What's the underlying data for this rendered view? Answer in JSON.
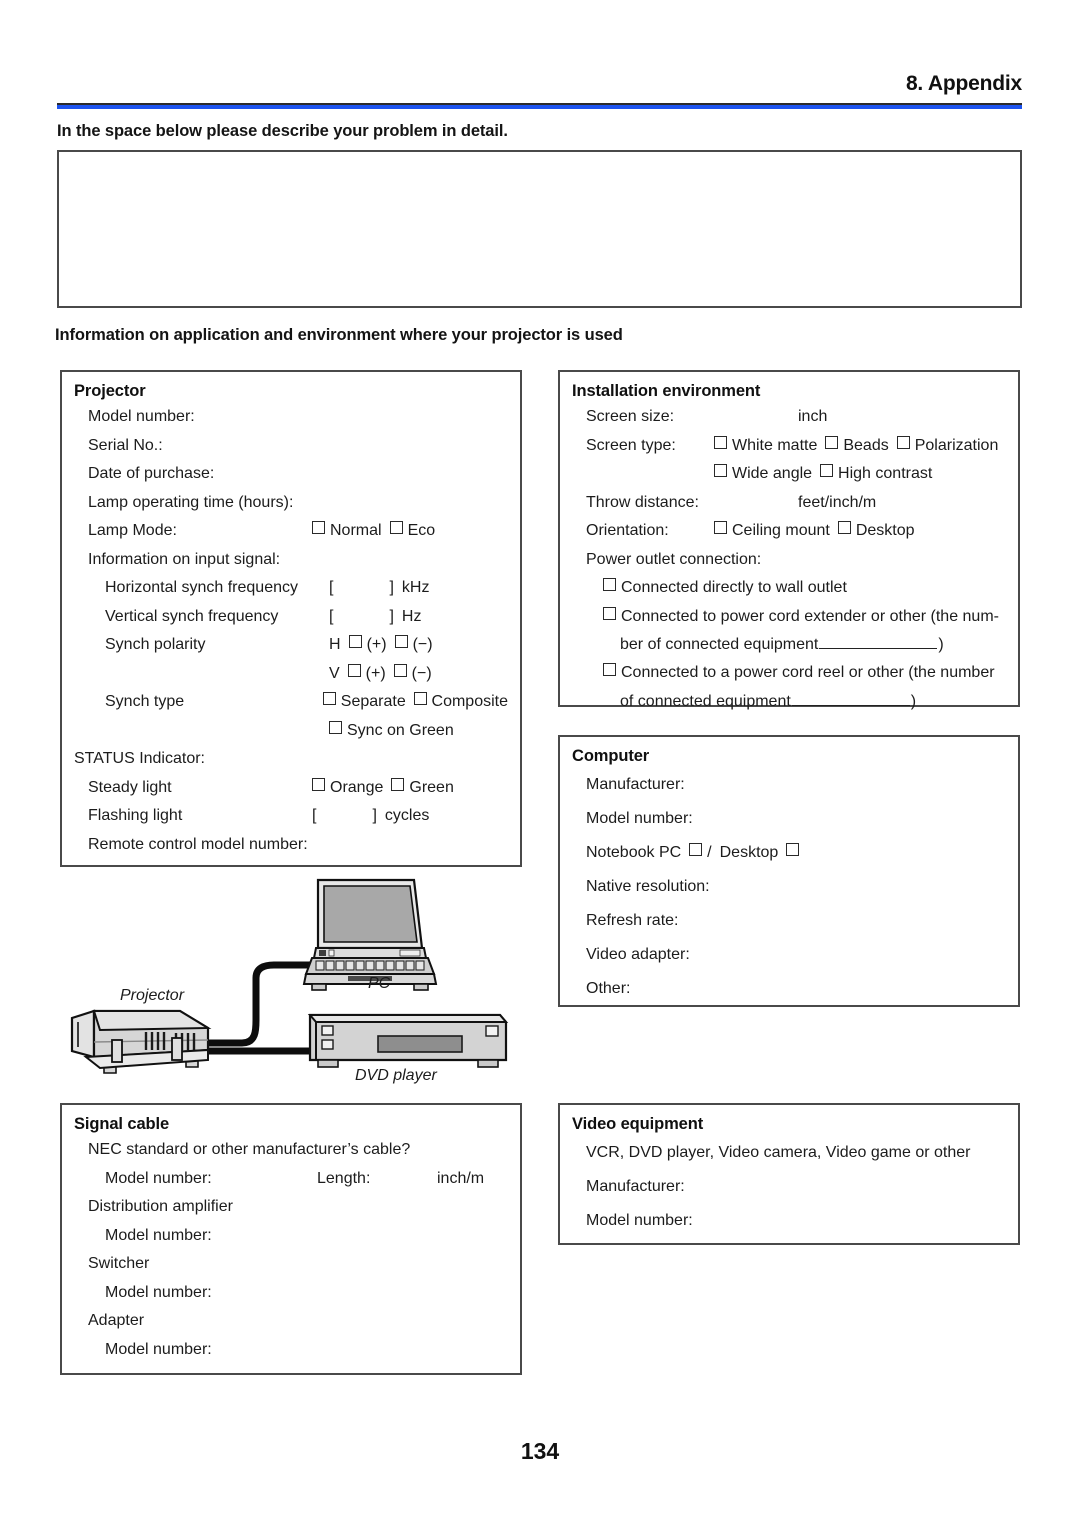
{
  "header": {
    "title": "8. Appendix",
    "rule_color": "#1d53ef"
  },
  "problem": {
    "prompt": "In the space below please describe your problem in detail.",
    "box_value": ""
  },
  "section_heading": "Information on application and environment where your projector is used",
  "projector": {
    "title": "Projector",
    "model_number_label": "Model number:",
    "serial_no_label": "Serial No.:",
    "date_of_purchase_label": "Date of purchase:",
    "lamp_operating_time_label": "Lamp operating time (hours):",
    "lamp_mode_label": "Lamp Mode:",
    "lamp_mode_options": [
      "Normal",
      "Eco"
    ],
    "input_signal_label": "Information on input signal:",
    "h_sync_label": "Horizontal synch frequency",
    "h_sync_open": "[",
    "h_sync_close": "]",
    "h_sync_unit": "kHz",
    "v_sync_label": "Vertical synch frequency",
    "v_sync_open": "[",
    "v_sync_close": "]",
    "v_sync_unit": "Hz",
    "synch_polarity_label": "Synch polarity",
    "polarity_h_prefix": "H",
    "polarity_v_prefix": "V",
    "polarity_plus": "(+)",
    "polarity_minus": "(−)",
    "synch_type_label": "Synch type",
    "synch_type_options": [
      "Separate",
      "Composite"
    ],
    "sync_on_green": "Sync on Green",
    "status_indicator_label": "STATUS Indicator:",
    "steady_light_label": "Steady light",
    "steady_light_options": [
      "Orange",
      "Green"
    ],
    "flashing_light_label": "Flashing light",
    "flashing_open": "[",
    "flashing_close": "]",
    "flashing_unit": "cycles",
    "remote_model_label": "Remote control model number:"
  },
  "installation": {
    "title": "Installation environment",
    "screen_size_label": "Screen size:",
    "screen_size_unit": "inch",
    "screen_type_label": "Screen type:",
    "screen_type_options_row1": [
      "White matte",
      "Beads",
      "Polarization"
    ],
    "screen_type_options_row2": [
      "Wide angle",
      "High contrast"
    ],
    "throw_distance_label": "Throw distance:",
    "throw_distance_unit": "feet/inch/m",
    "orientation_label": "Orientation:",
    "orientation_options": [
      "Ceiling mount",
      "Desktop"
    ],
    "power_outlet_label": "Power outlet connection:",
    "power_option_1": "Connected directly to wall outlet",
    "power_option_2_a": "Connected to power cord extender or other (the num-",
    "power_option_2_b": "ber of connected equipment",
    "power_option_2_c": ")",
    "power_option_3_a": "Connected to a power cord reel or other (the number",
    "power_option_3_b": "of connected equipment",
    "power_option_3_c": ")"
  },
  "computer": {
    "title": "Computer",
    "manufacturer_label": "Manufacturer:",
    "model_number_label": "Model number:",
    "notebook_label": "Notebook PC",
    "separator": "/",
    "desktop_label": "Desktop",
    "native_resolution_label": "Native resolution:",
    "refresh_rate_label": "Refresh rate:",
    "video_adapter_label": "Video adapter:",
    "other_label": "Other:"
  },
  "signal_cable": {
    "title": "Signal cable",
    "nec_question": "NEC standard or other manufacturer’s cable?",
    "model_number_label": "Model number:",
    "length_label": "Length:",
    "length_unit": "inch/m",
    "distribution_amplifier_label": "Distribution amplifier",
    "distribution_model_label": "Model number:",
    "switcher_label": "Switcher",
    "switcher_model_label": "Model number:",
    "adapter_label": "Adapter",
    "adapter_model_label": "Model number:"
  },
  "video_equipment": {
    "title": "Video equipment",
    "types_line": "VCR, DVD player, Video camera, Video game or other",
    "manufacturer_label": "Manufacturer:",
    "model_number_label": "Model number:"
  },
  "diagram": {
    "projector_label": "Projector",
    "pc_label": "PC",
    "dvd_label": "DVD player"
  },
  "page_number": "134"
}
